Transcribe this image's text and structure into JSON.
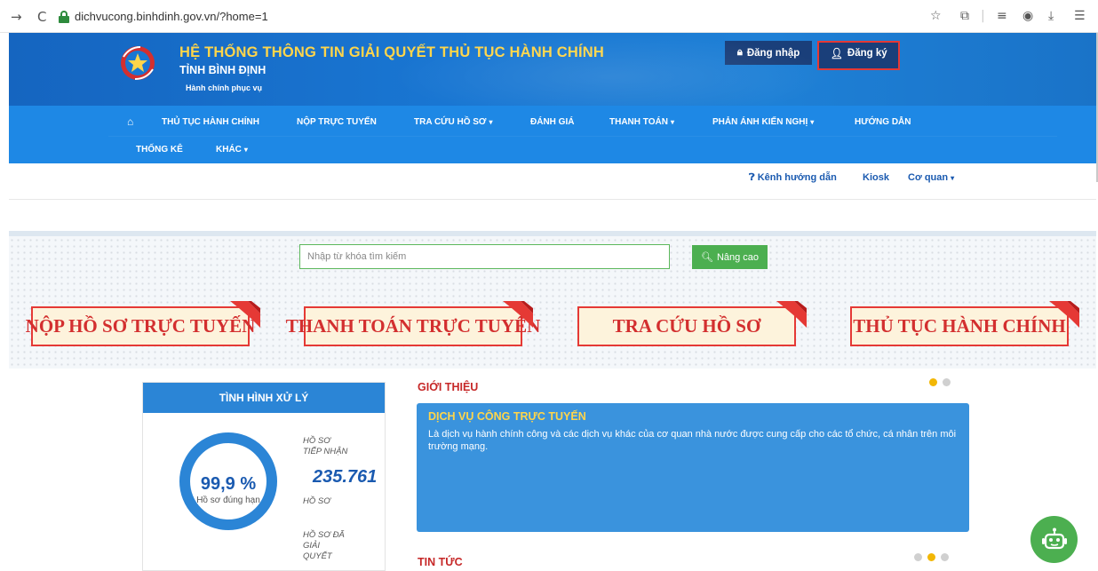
{
  "browser": {
    "url": "dichvucong.binhdinh.gov.vn/?home=1",
    "back_icon": "→",
    "reload_icon": "C"
  },
  "header": {
    "title": "HỆ THỐNG THÔNG TIN GIẢI QUYẾT THỦ TỤC HÀNH CHÍNH",
    "subtitle": "TỈNH BÌNH ĐỊNH",
    "slogan": "Hành chính phục vụ",
    "login_label": "Đăng nhập",
    "register_label": "Đăng ký",
    "title_color": "#ffd54a",
    "brand_color": "#1976d2"
  },
  "nav": {
    "items": [
      {
        "label": "THỦ TỤC HÀNH CHÍNH",
        "dropdown": false
      },
      {
        "label": "NỘP TRỰC TUYẾN",
        "dropdown": false
      },
      {
        "label": "TRA CỨU HỒ SƠ",
        "dropdown": true
      },
      {
        "label": "ĐÁNH GIÁ",
        "dropdown": false
      },
      {
        "label": "THANH TOÁN",
        "dropdown": true
      },
      {
        "label": "PHẢN ÁNH KIẾN NGHỊ",
        "dropdown": true
      },
      {
        "label": "HƯỚNG DẪN",
        "dropdown": false
      },
      {
        "label": "THỐNG KÊ",
        "dropdown": false
      },
      {
        "label": "KHÁC",
        "dropdown": true
      }
    ],
    "caret": "▾"
  },
  "subnav": {
    "guide": "Kênh hướng dẫn",
    "kiosk": "Kiosk",
    "agency": "Cơ quan"
  },
  "search": {
    "placeholder": "Nhập từ khóa tìm kiếm",
    "value": "",
    "button": "Nâng cao"
  },
  "banners": [
    {
      "label": "NỘP HỒ SƠ TRỰC TUYẾN"
    },
    {
      "label": "THANH TOÁN TRỰC TUYẾN"
    },
    {
      "label": "TRA CỨU HỒ SƠ"
    },
    {
      "label": "THỦ TỤC HÀNH CHÍNH"
    }
  ],
  "stats": {
    "title": "TÌNH HÌNH XỬ LÝ",
    "percent": "99,9 %",
    "percent_value": 99.9,
    "percent_label": "Hồ sơ đúng hạn",
    "received_label_1": "HỒ SƠ",
    "received_label_2": "TIẾP NHẬN",
    "received_value": "235.761",
    "received_unit": "HỒ SƠ",
    "solved_label_1": "HỒ SƠ ĐÃ",
    "solved_label_2": "GIẢI",
    "solved_label_3": "QUYẾT"
  },
  "intro": {
    "section_title": "GIỚI THIỆU",
    "card_title": "DỊCH VỤ CÔNG TRỰC TUYẾN",
    "card_text": "Là dịch vụ hành chính công và các dịch vụ khác của cơ quan nhà nước được cung cấp cho các tổ chức, cá nhân trên môi trường mạng."
  },
  "news": {
    "section_title": "TIN TỨC"
  }
}
